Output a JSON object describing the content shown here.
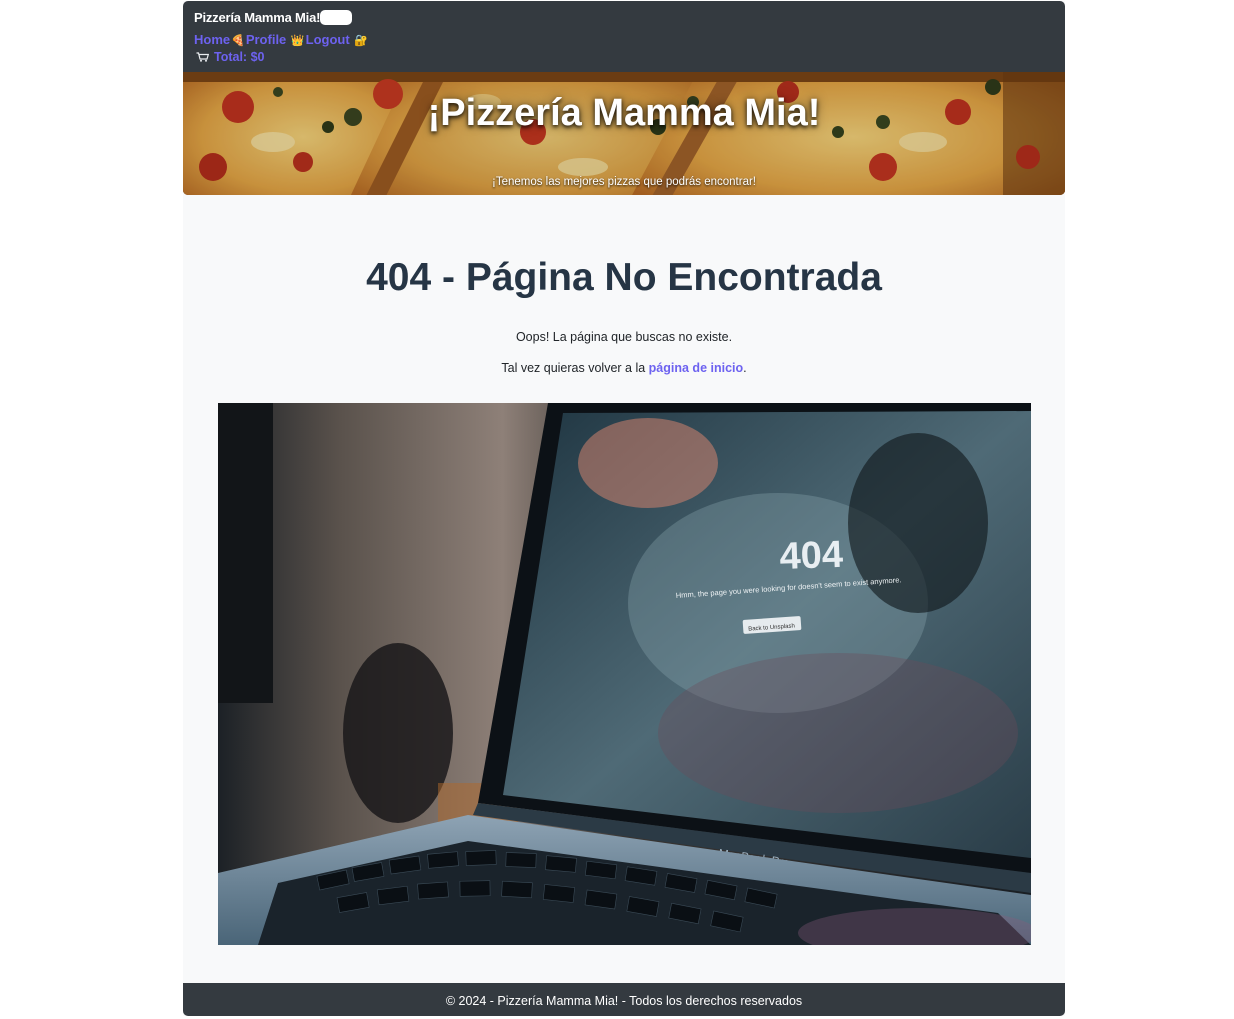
{
  "navbar": {
    "brand": "Pizzería Mamma Mia!",
    "links": {
      "home": "Home",
      "profile": "Profile",
      "logout": "Logout"
    },
    "emojis": {
      "home": "🍕",
      "profile": "👑",
      "logout": "🔐"
    },
    "total_label": "Total: $0",
    "icons": [
      "pizza-slice-icon",
      "crown-icon",
      "lock-icon",
      "cart-icon"
    ]
  },
  "hero": {
    "title": "¡Pizzería Mamma Mia!",
    "subtitle": "¡Tenemos las mejores pizzas que podrás encontrar!"
  },
  "main": {
    "title": "404 - Página No Encontrada",
    "message": "Oops! La página que buscas no existe.",
    "suggestion_prefix": "Tal vez quieras volver a la ",
    "home_link": "página de inicio",
    "suggestion_suffix": "."
  },
  "photo": {
    "screen_code": "404",
    "screen_message": "Hmm, the page you were looking for doesn't seem to exist anymore.",
    "screen_button": "Back to Unsplash",
    "laptop_brand": "MacBook Pro"
  },
  "footer": {
    "text": "© 2024 - Pizzería Mamma Mia! - Todos los derechos reservados"
  },
  "colors": {
    "navbar_bg": "#343a40",
    "link": "#6d62f0",
    "heading": "#263545",
    "page_bg": "#f8f9fa"
  }
}
